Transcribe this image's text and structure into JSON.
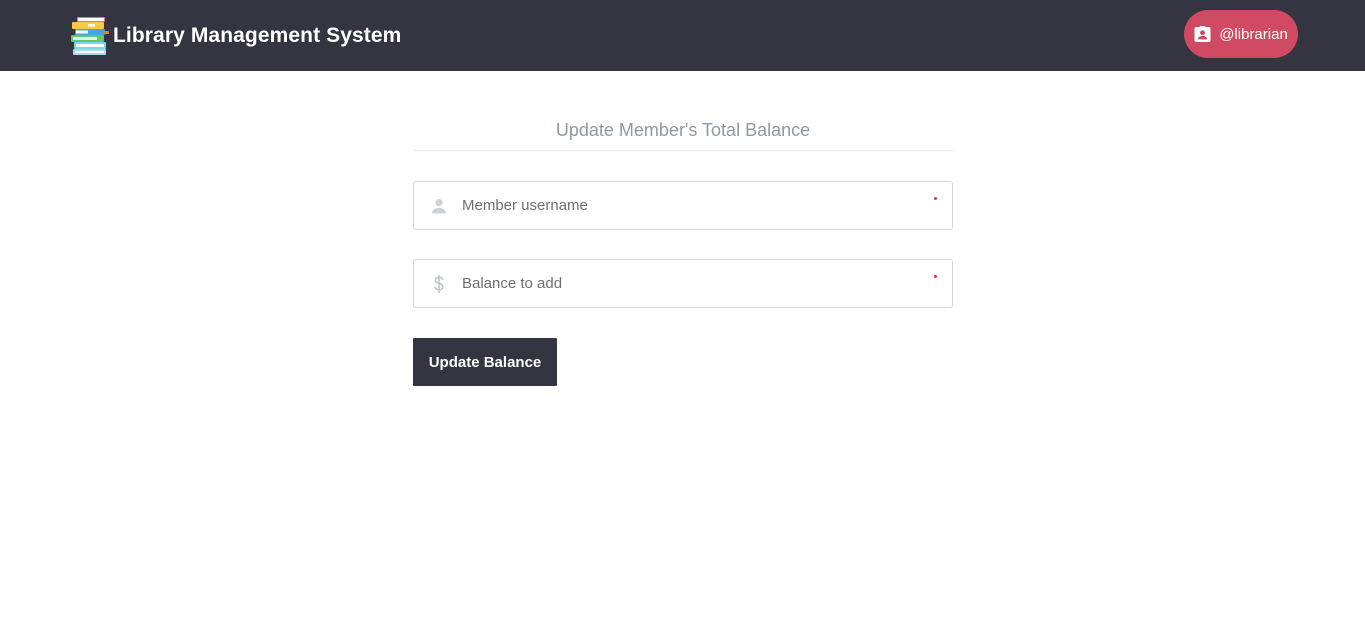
{
  "header": {
    "app_title": "Library Management System",
    "logo_icon": "book-stack-icon",
    "user": {
      "label": "@librarian",
      "icon": "contact-badge-icon",
      "color": "#d04a63"
    },
    "background_color": "#343541"
  },
  "form": {
    "title": "Update Member's Total Balance",
    "fields": [
      {
        "placeholder": "Member username",
        "value": "",
        "icon": "user-icon",
        "required": true
      },
      {
        "placeholder": "Balance to add",
        "value": "",
        "icon": "dollar-icon",
        "required": true
      }
    ],
    "submit_label": "Update Balance"
  }
}
